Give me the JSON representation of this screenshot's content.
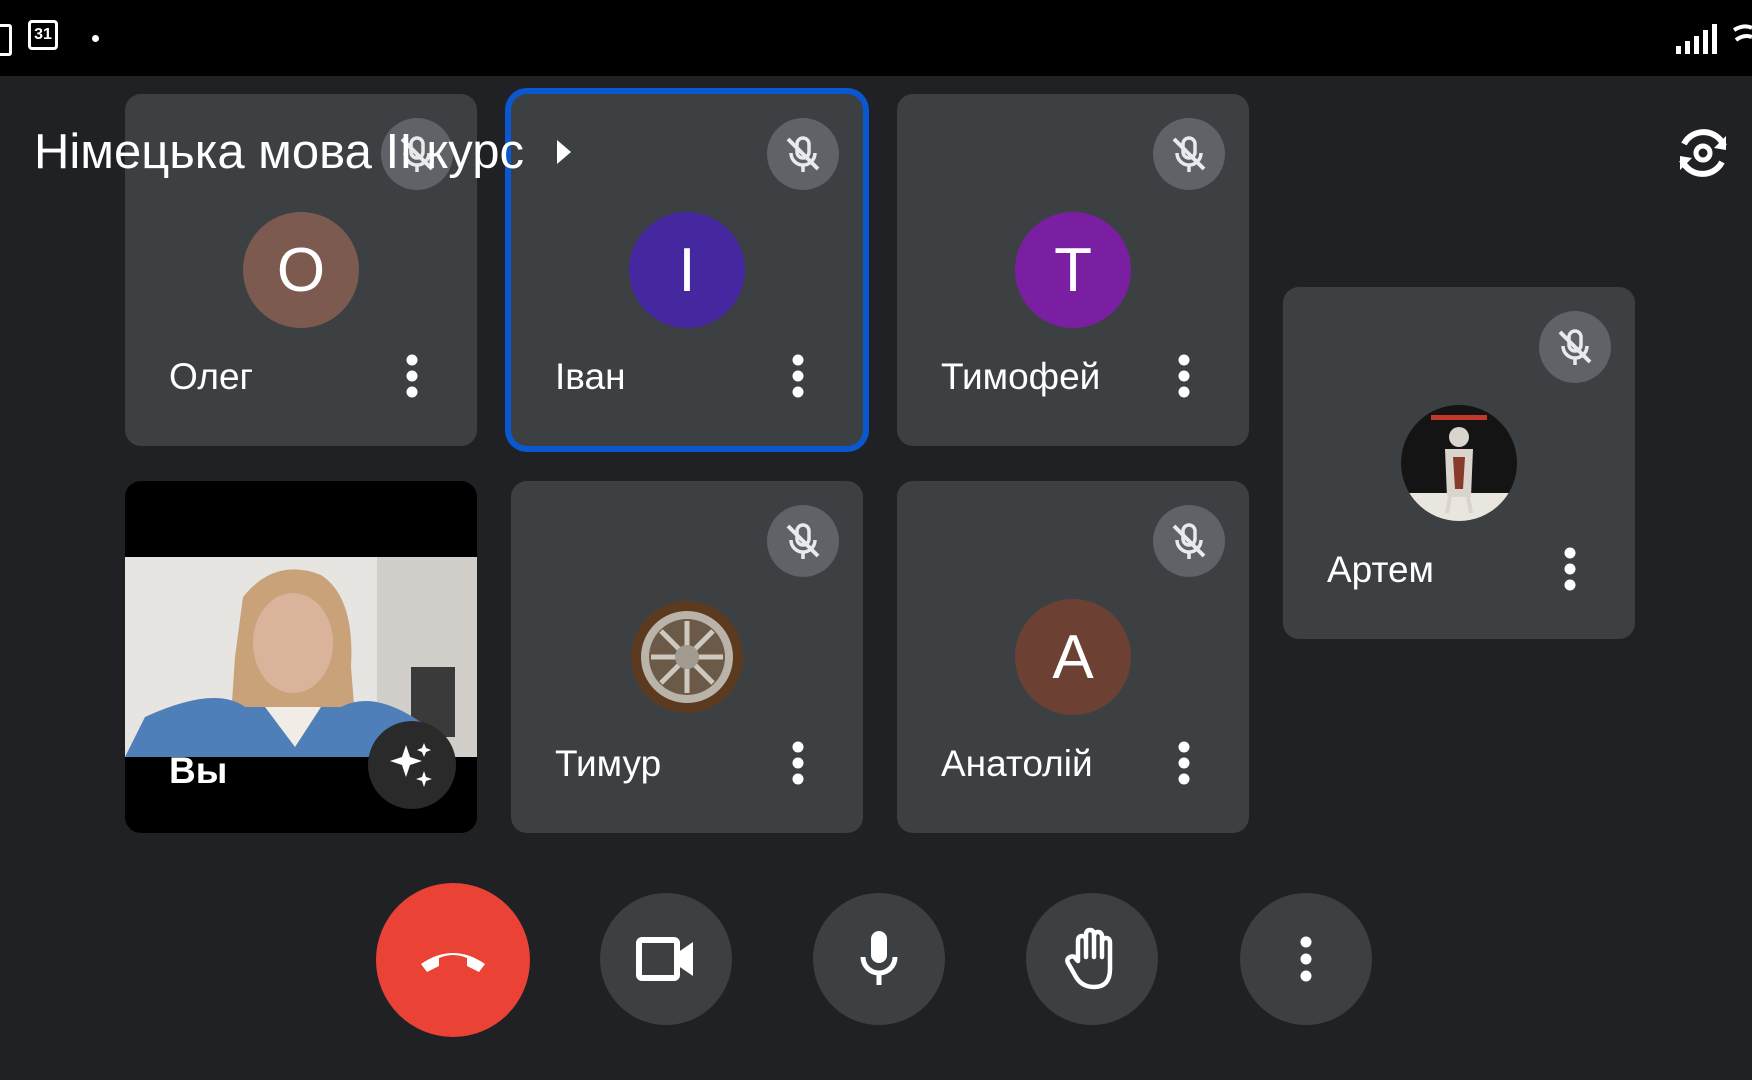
{
  "status_bar": {
    "calendar_day": "31",
    "icons": [
      "screen-icon",
      "calendar-icon",
      "notification-dot-icon",
      "signal-icon",
      "wifi-icon"
    ]
  },
  "meeting": {
    "title": "Німецька мова ІІ курс"
  },
  "participants": [
    {
      "name": "Олег",
      "initial": "О",
      "avatar_color": "#7d5a50",
      "muted": true
    },
    {
      "name": "Іван",
      "initial": "І",
      "avatar_color": "#4527a0",
      "muted": true,
      "active_speaker": true
    },
    {
      "name": "Тимофей",
      "initial": "Т",
      "avatar_color": "#7b1fa2",
      "muted": true
    },
    {
      "name": "Артем",
      "avatar": "photo",
      "muted": true
    },
    {
      "name": "Тимур",
      "avatar": "photo",
      "muted": true
    },
    {
      "name": "Анатолій",
      "initial": "А",
      "avatar_color": "#6d4034",
      "muted": true
    }
  ],
  "self": {
    "name": "Вы"
  },
  "controls": {
    "items": [
      "end-call",
      "camera",
      "microphone",
      "raise-hand",
      "more-options"
    ],
    "end_call_color": "#ea4335"
  },
  "colors": {
    "tile_bg": "#3c4043",
    "background": "#202124",
    "active_border": "#0b57d0"
  }
}
